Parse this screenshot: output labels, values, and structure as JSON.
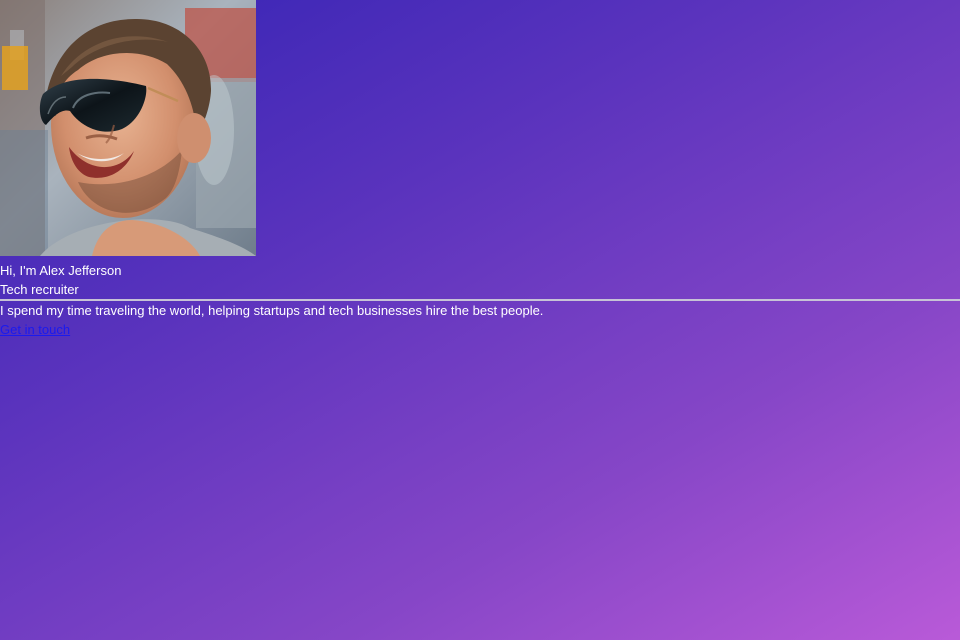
{
  "profile": {
    "avatar_alt": "Portrait of a smiling man wearing sunglasses",
    "greeting": "Hi, I'm Alex Jefferson",
    "role": "Tech recruiter",
    "bio": "I spend my time traveling the world, helping startups and tech businesses hire the best people.",
    "cta_label": "Get in touch"
  },
  "colors": {
    "background_start": "#3323b4",
    "background_end": "#b95ad8",
    "text": "#ffffff",
    "link": "#1a1aee",
    "divider": "#c7c3d6"
  }
}
